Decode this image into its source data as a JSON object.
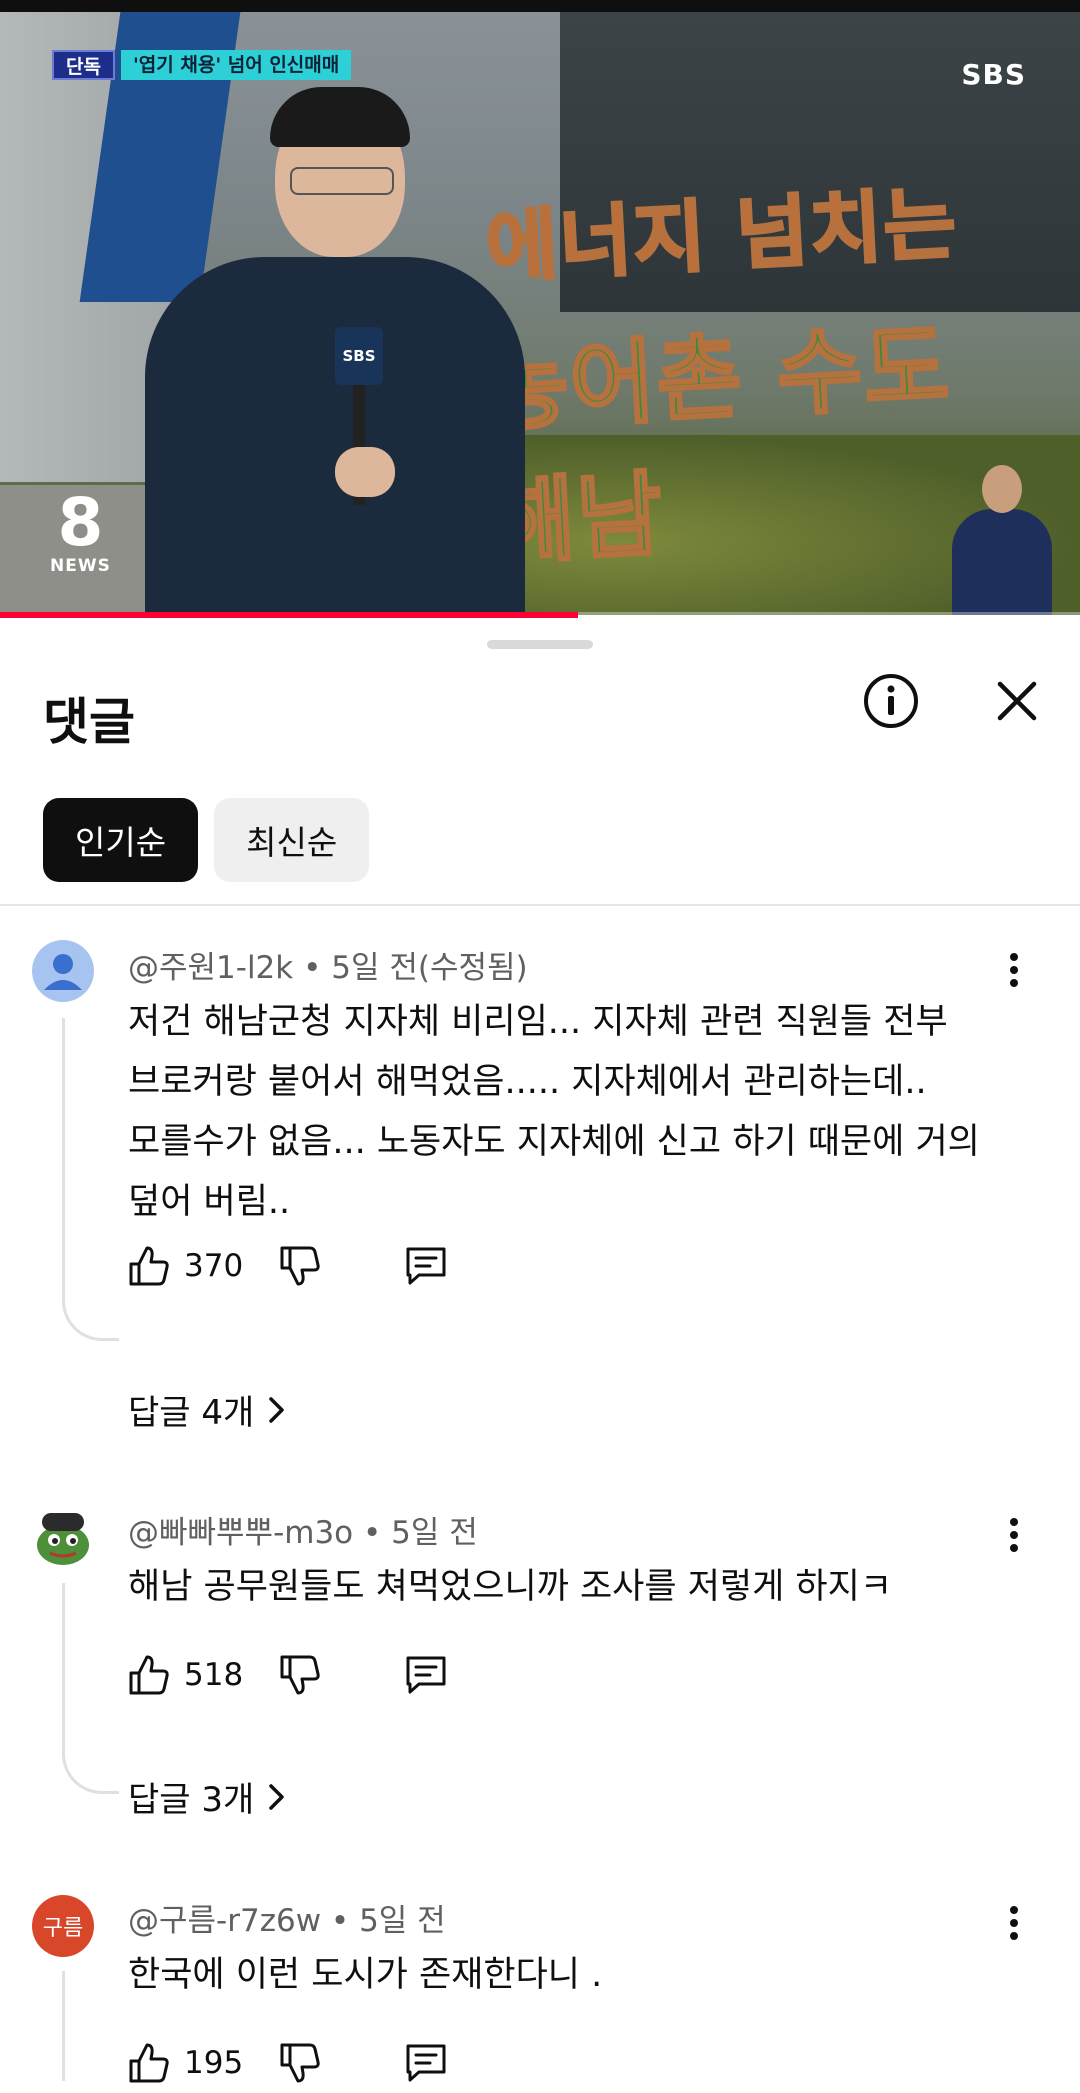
{
  "video": {
    "news_tag": "단독",
    "news_headline": "'엽기 채용' 넘어 인신매매",
    "channel_logo": "SBS",
    "mic_label": "SBS",
    "sign_line1": "에너지 넘치는",
    "sign_line2": "농어촌 수도 해남",
    "program_number": "8",
    "program_label": "NEWS",
    "progress_fraction": 0.535,
    "accent_color": "#ff0033"
  },
  "sheet": {
    "title": "댓글",
    "info_icon": "info-circle-icon",
    "close_icon": "close-icon",
    "sort_chips": [
      {
        "label": "인기순",
        "active": true
      },
      {
        "label": "최신순",
        "active": false
      }
    ]
  },
  "comments": [
    {
      "author": "@주원1-l2k",
      "time": "5일 전(수정됨)",
      "lines": [
        "저건 해남군청 지자체 비리임... 지자체 관련 직원들 전부",
        "브로커랑 붙어서 해먹었음..... 지자체에서 관리하는데..",
        "모를수가 없음... 노동자도 지자체에 신고 하기 때문에 거의",
        "덮어 버림.."
      ],
      "likes": "370",
      "replies": "답글 4개"
    },
    {
      "author": "@빠빠뿌뿌-m3o",
      "time": "5일 전",
      "lines": [
        "해남 공무원들도 쳐먹었으니까 조사를 저렇게 하지ㅋ"
      ],
      "likes": "518",
      "replies": "답글 3개"
    },
    {
      "author": "@구름-r7z6w",
      "time": "5일 전",
      "avatar_text": "구름",
      "lines": [
        "한국에 이런 도시가 존재한다니 ."
      ],
      "likes": "195"
    }
  ],
  "separator": "•"
}
